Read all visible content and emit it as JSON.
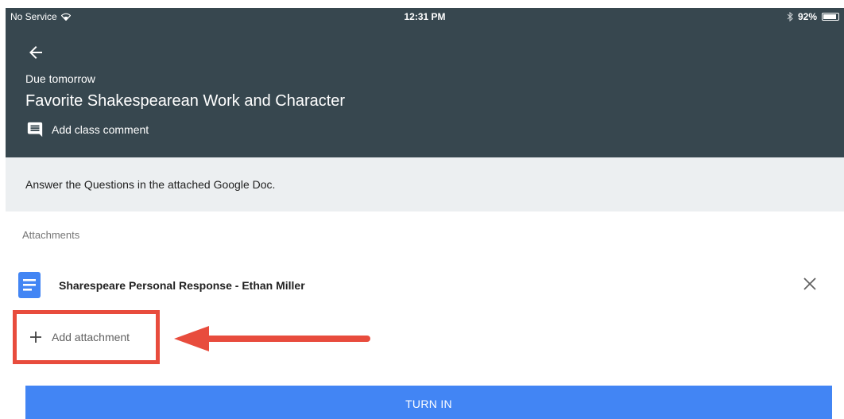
{
  "status_bar": {
    "carrier": "No Service",
    "time": "12:31 PM",
    "battery_percent": "92%",
    "battery_level": 0.92,
    "icons": [
      "wifi-icon",
      "bluetooth-icon",
      "battery-icon"
    ]
  },
  "header": {
    "back_icon": "arrow-back-icon",
    "due": "Due tomorrow",
    "title": "Favorite Shakespearean Work and Character",
    "comment_icon": "comment-icon",
    "comment_label": "Add class comment"
  },
  "instructions": "Answer the Questions in the attached Google Doc.",
  "attachments": {
    "label": "Attachments",
    "items": [
      {
        "icon": "google-doc-icon",
        "name": "Sharespeare Personal Response - Ethan Miller",
        "remove_icon": "close-icon"
      }
    ],
    "add_label": "Add attachment",
    "add_icon": "plus-icon"
  },
  "turn_in_label": "TURN IN",
  "colors": {
    "header_bg": "#37474f",
    "instructions_bg": "#eceff1",
    "highlight": "#e84c3d",
    "button_bg": "#4285f4",
    "doc_icon": "#4285f4"
  }
}
